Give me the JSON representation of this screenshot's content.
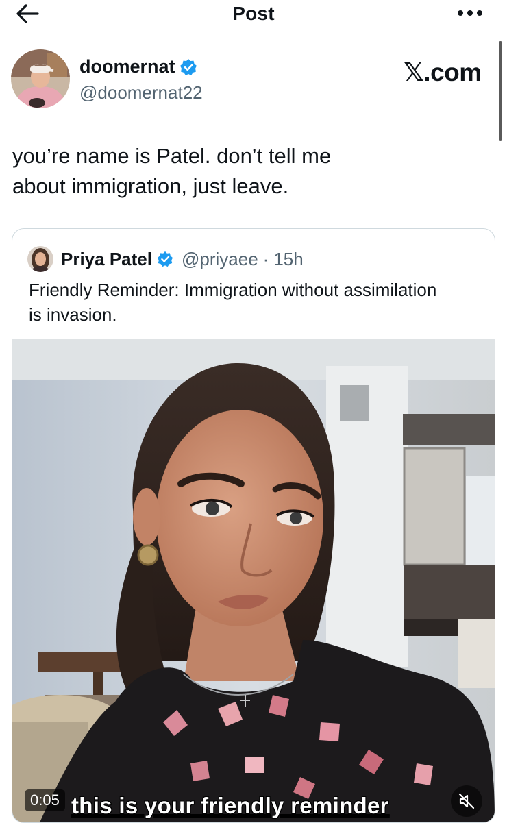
{
  "header": {
    "title": "Post",
    "back_icon": "arrow-left-icon",
    "more_icon": "more-dots-icon"
  },
  "post": {
    "author_name": "doomernat",
    "author_handle": "@doomernat22",
    "verified": true,
    "text_line1": "you’re name is Patel. don’t tell me",
    "text_line2": "about immigration, just leave.",
    "watermark": "𝕏.com"
  },
  "quoted_post": {
    "author_name": "Priya Patel",
    "author_handle": "@priyaee",
    "separator": "·",
    "age": "15h",
    "verified": true,
    "text_line1": "Friendly Reminder: Immigration without assimilation",
    "text_line2": "is invasion.",
    "video": {
      "time": "0:05",
      "caption": "this is your friendly reminder",
      "muted": true,
      "mute_icon": "speaker-muted-icon"
    }
  },
  "colors": {
    "verified_blue": "#1d9bf0",
    "secondary_text": "#536471",
    "border": "#cfd9de"
  }
}
